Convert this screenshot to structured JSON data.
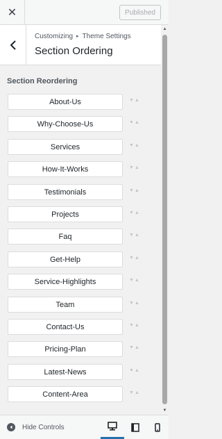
{
  "topbar": {
    "close_glyph": "✕",
    "published_label": "Published"
  },
  "header": {
    "breadcrumb_root": "Customizing",
    "breadcrumb_sep": "▸",
    "breadcrumb_child": "Theme Settings",
    "title": "Section Ordering"
  },
  "panel": {
    "label": "Section Reordering",
    "items": [
      {
        "label": "About-Us"
      },
      {
        "label": "Why-Choose-Us"
      },
      {
        "label": "Services"
      },
      {
        "label": "How-It-Works"
      },
      {
        "label": "Testimonials"
      },
      {
        "label": "Projects"
      },
      {
        "label": "Faq"
      },
      {
        "label": "Get-Help"
      },
      {
        "label": "Service-Highlights"
      },
      {
        "label": "Team"
      },
      {
        "label": "Contact-Us"
      },
      {
        "label": "Pricing-Plan"
      },
      {
        "label": "Latest-News"
      },
      {
        "label": "Content-Area"
      }
    ]
  },
  "footer": {
    "hide_controls_label": "Hide Controls",
    "active_device": "desktop"
  },
  "colors": {
    "accent": "#2271b1",
    "background": "#f1f1f1"
  }
}
